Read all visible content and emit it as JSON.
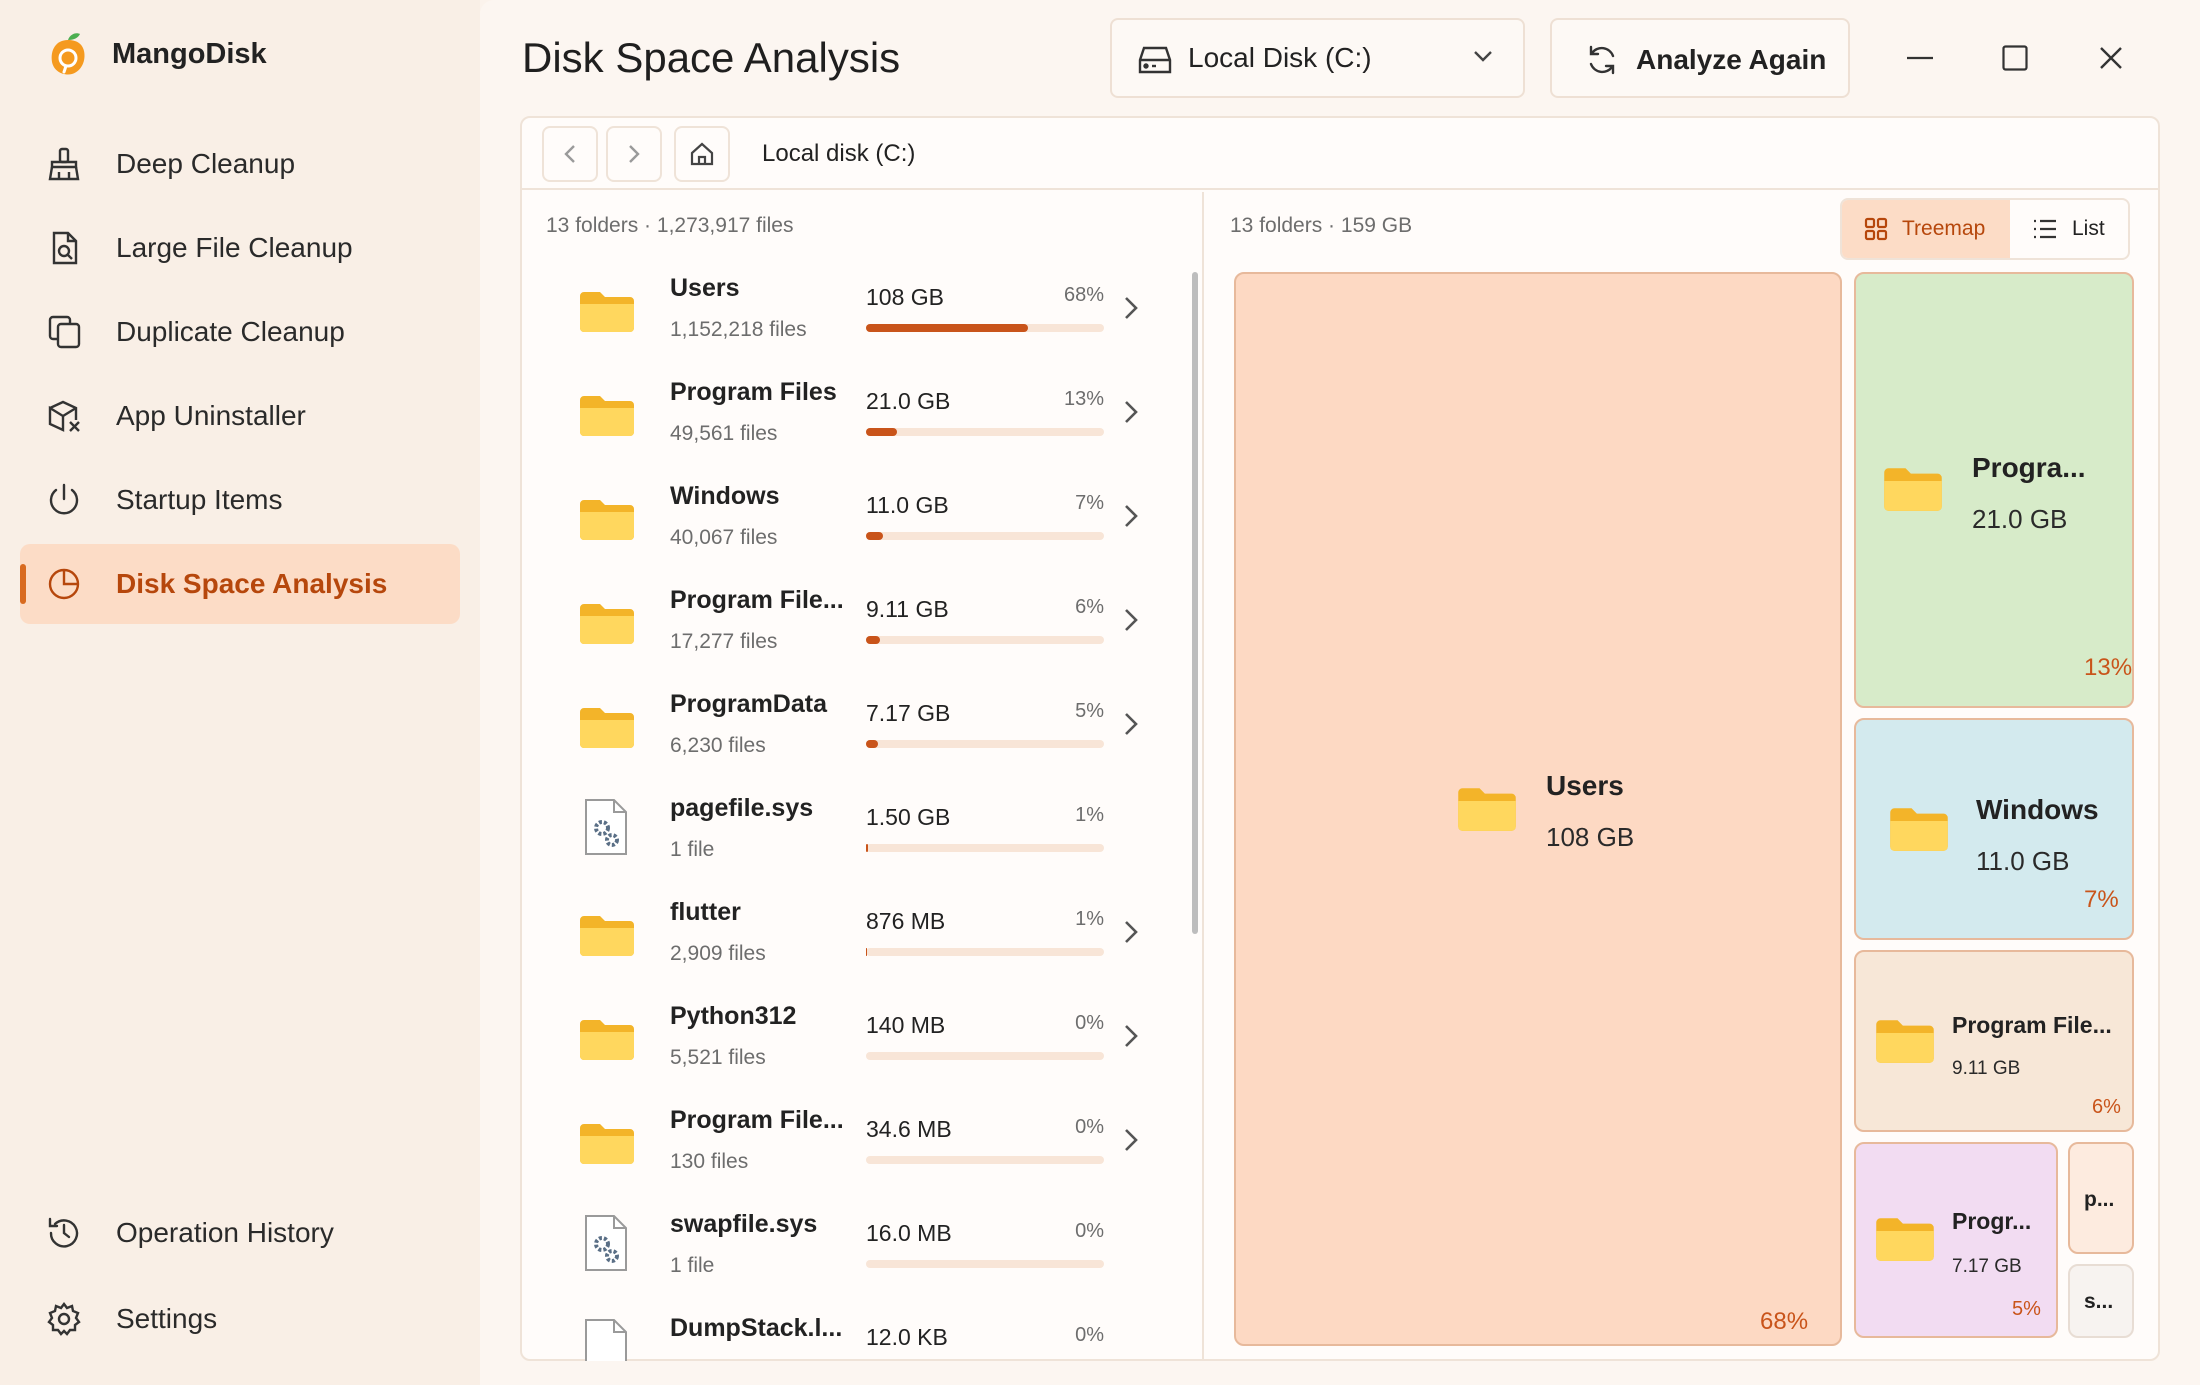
{
  "app": {
    "name": "MangoDisk"
  },
  "sidebar": {
    "items": [
      {
        "label": "Deep Cleanup"
      },
      {
        "label": "Large File Cleanup"
      },
      {
        "label": "Duplicate Cleanup"
      },
      {
        "label": "App Uninstaller"
      },
      {
        "label": "Startup Items"
      },
      {
        "label": "Disk Space Analysis",
        "active": true
      }
    ],
    "bottom": [
      {
        "label": "Operation History"
      },
      {
        "label": "Settings"
      }
    ]
  },
  "header": {
    "title": "Disk Space Analysis",
    "drive": "Local Disk (C:)",
    "analyze_label": "Analyze Again"
  },
  "path": {
    "current": "Local disk (C:)"
  },
  "list": {
    "summary": "13 folders · 1,273,917 files",
    "rows": [
      {
        "name": "Users",
        "count": "1,152,218 files",
        "size": "108 GB",
        "pct": "68%",
        "fraction": 0.68,
        "type": "folder"
      },
      {
        "name": "Program Files",
        "count": "49,561 files",
        "size": "21.0 GB",
        "pct": "13%",
        "fraction": 0.13,
        "type": "folder"
      },
      {
        "name": "Windows",
        "count": "40,067 files",
        "size": "11.0 GB",
        "pct": "7%",
        "fraction": 0.07,
        "type": "folder"
      },
      {
        "name": "Program File...",
        "count": "17,277 files",
        "size": "9.11 GB",
        "pct": "6%",
        "fraction": 0.06,
        "type": "folder"
      },
      {
        "name": "ProgramData",
        "count": "6,230 files",
        "size": "7.17 GB",
        "pct": "5%",
        "fraction": 0.05,
        "type": "folder"
      },
      {
        "name": "pagefile.sys",
        "count": "1 file",
        "size": "1.50 GB",
        "pct": "1%",
        "fraction": 0.01,
        "type": "sysfile"
      },
      {
        "name": "flutter",
        "count": "2,909 files",
        "size": "876 MB",
        "pct": "1%",
        "fraction": 0.005,
        "type": "folder"
      },
      {
        "name": "Python312",
        "count": "5,521 files",
        "size": "140 MB",
        "pct": "0%",
        "fraction": 0.001,
        "type": "folder"
      },
      {
        "name": "Program File...",
        "count": "130 files",
        "size": "34.6 MB",
        "pct": "0%",
        "fraction": 0.0,
        "type": "folder"
      },
      {
        "name": "swapfile.sys",
        "count": "1 file",
        "size": "16.0 MB",
        "pct": "0%",
        "fraction": 0.0,
        "type": "sysfile"
      },
      {
        "name": "DumpStack.l...",
        "count": "",
        "size": "12.0 KB",
        "pct": "0%",
        "fraction": 0.0,
        "type": "file"
      }
    ]
  },
  "treemap": {
    "summary": "13 folders · 159 GB",
    "view_treemap": "Treemap",
    "view_list": "List",
    "tiles": [
      {
        "name": "Users",
        "size": "108 GB",
        "pct": "68%",
        "color": "#fdd9c3"
      },
      {
        "name": "Progra...",
        "size": "21.0 GB",
        "pct": "13%",
        "color": "#d7ebc9"
      },
      {
        "name": "Windows",
        "size": "11.0 GB",
        "pct": "7%",
        "color": "#d3eaee"
      },
      {
        "name": "Program File...",
        "size": "9.11 GB",
        "pct": "6%",
        "color": "#f7e7d7"
      },
      {
        "name": "Progr...",
        "size": "7.17 GB",
        "pct": "5%",
        "color": "#f2dcf2"
      },
      {
        "name": "p...",
        "color": "#fdebdf"
      },
      {
        "name": "s...",
        "color": "#f7f3f0"
      }
    ]
  },
  "colors": {
    "accent": "#c9541a",
    "active_bg": "#fcdcc6",
    "folder": "#f7c948"
  }
}
